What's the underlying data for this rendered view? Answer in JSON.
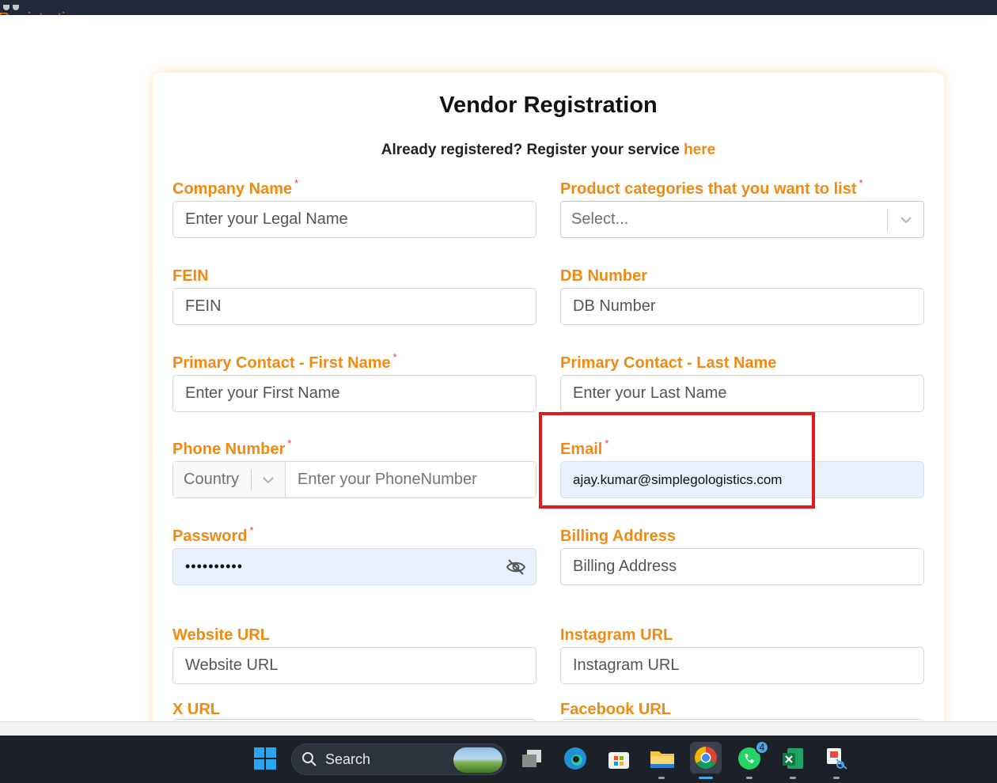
{
  "breadcrumb": "Registration",
  "form": {
    "title": "Vendor Registration",
    "subtitle_text": "Already registered? Register your service",
    "subtitle_link": "here",
    "company_name": {
      "label": "Company Name",
      "placeholder": "Enter your Legal Name"
    },
    "product_categories": {
      "label": "Product categories that you want to list",
      "placeholder": "Select..."
    },
    "fein": {
      "label": "FEIN",
      "placeholder": "FEIN"
    },
    "db_number": {
      "label": "DB Number",
      "placeholder": "DB Number"
    },
    "first_name": {
      "label": "Primary Contact - First Name",
      "placeholder": "Enter your First Name"
    },
    "last_name": {
      "label": "Primary Contact - Last Name",
      "placeholder": "Enter your Last Name"
    },
    "phone": {
      "label": "Phone Number",
      "country_placeholder": "Country",
      "placeholder": "Enter your PhoneNumber"
    },
    "email": {
      "label": "Email",
      "value": "ajay.kumar@simplegologistics.com"
    },
    "password": {
      "label": "Password",
      "value": "••••••••••"
    },
    "billing_address": {
      "label": "Billing Address",
      "placeholder": "Billing Address"
    },
    "website_url": {
      "label": "Website URL",
      "placeholder": "Website URL"
    },
    "instagram_url": {
      "label": "Instagram URL",
      "placeholder": "Instagram URL"
    },
    "x_url": {
      "label": "X URL"
    },
    "facebook_url": {
      "label": "Facebook URL"
    },
    "required_mark": "*"
  },
  "taskbar": {
    "search_label": "Search",
    "whatsapp_badge": "4",
    "icons": [
      "windows-start-icon",
      "search-icon",
      "task-view-icon",
      "edge-icon",
      "store-icon",
      "file-explorer-icon",
      "chrome-icon",
      "whatsapp-icon",
      "excel-icon",
      "snipping-tool-icon"
    ]
  },
  "colors": {
    "accent": "#f08a12",
    "required": "#e53935",
    "highlight": "#e01b1b",
    "autofill_bg": "#e8f0fe"
  }
}
